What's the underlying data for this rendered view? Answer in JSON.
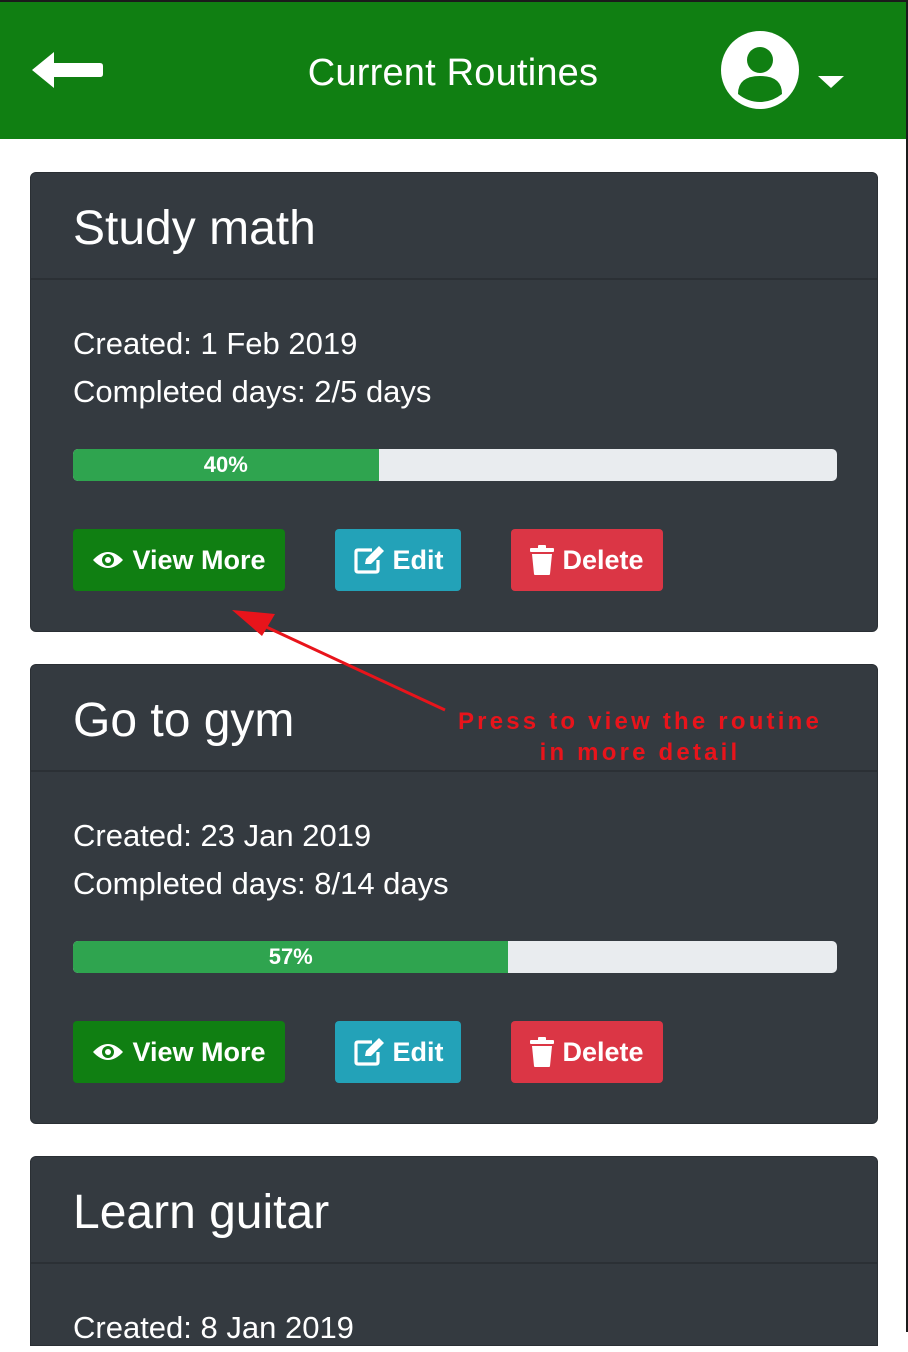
{
  "header": {
    "title": "Current Routines",
    "background_color": "#107f12",
    "back_icon": "arrow-left-icon",
    "user_icon": "user-circle-icon",
    "menu_icon": "caret-down-icon"
  },
  "routines": [
    {
      "title": "Study math",
      "created": "Created: 1 Feb 2019",
      "completed": "Completed days: 2/5 days",
      "progress_label": "40%",
      "progress_fraction": 0.4,
      "view_label": "View More",
      "edit_label": "Edit",
      "delete_label": "Delete"
    },
    {
      "title": "Go to gym",
      "created": "Created: 23 Jan 2019",
      "completed": "Completed days: 8/14 days",
      "progress_label": "57%",
      "progress_fraction": 0.57,
      "view_label": "View More",
      "edit_label": "Edit",
      "delete_label": "Delete"
    },
    {
      "title": "Learn guitar",
      "created": "Created: 8 Jan 2019"
    }
  ],
  "annotation": {
    "line1": "Press to view the routine",
    "line2": "in more detail",
    "color": "#e8141b"
  },
  "colors": {
    "card_background": "#343a40",
    "progress_fill": "#2fa44f",
    "progress_track": "#e9ecef",
    "view_button": "#107f12",
    "edit_button": "#23a2b8",
    "delete_button": "#db3645"
  }
}
